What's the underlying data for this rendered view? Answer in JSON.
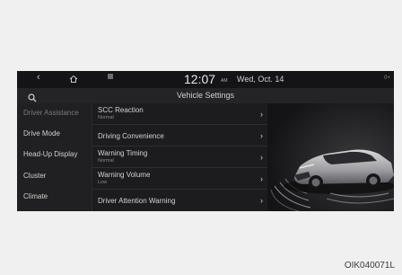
{
  "topbar": {
    "back_icon": "chevron-left-icon",
    "home_icon": "home-icon",
    "menu_icon": "menu-icon",
    "time": "12:07",
    "ampm": "AM",
    "date": "Wed, Oct. 14",
    "corner": "0+"
  },
  "titlebar": {
    "search_icon": "search-icon",
    "title": "Vehicle Settings"
  },
  "sidebar": {
    "items": [
      {
        "label": "Driver Assistance"
      },
      {
        "label": "Drive Mode"
      },
      {
        "label": "Head-Up Display"
      },
      {
        "label": "Cluster"
      },
      {
        "label": "Climate"
      }
    ]
  },
  "settings": {
    "rows": [
      {
        "label": "SCC Reaction",
        "value": "Normal"
      },
      {
        "label": "Driving Convenience",
        "value": ""
      },
      {
        "label": "Warning Timing",
        "value": "Normal"
      },
      {
        "label": "Warning Volume",
        "value": "Low"
      },
      {
        "label": "Driver Attention Warning",
        "value": ""
      }
    ],
    "chevron": "›"
  },
  "caption": "OIK040071L"
}
